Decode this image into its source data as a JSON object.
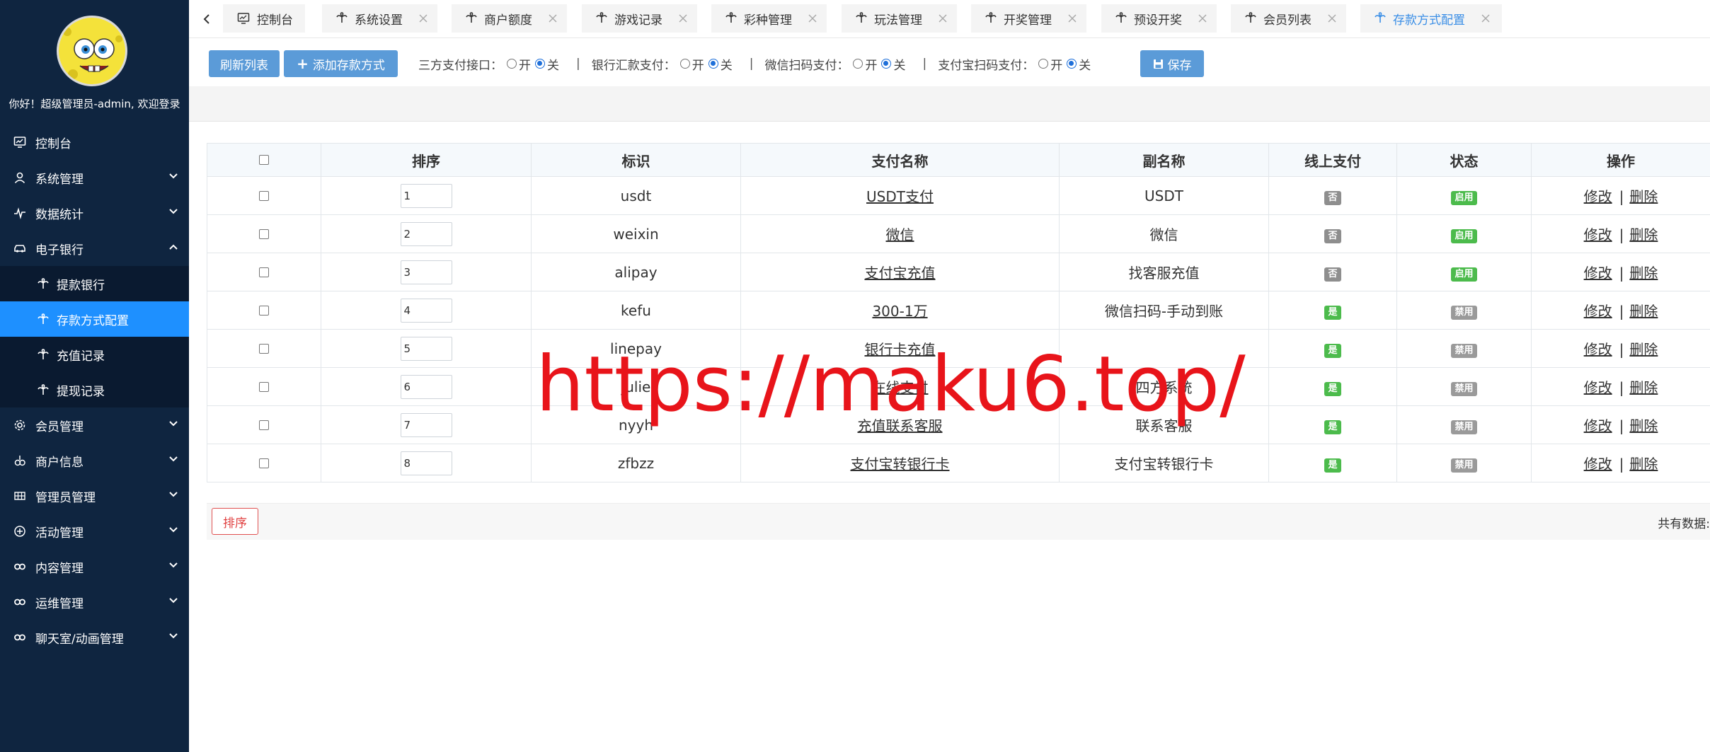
{
  "sidebar": {
    "welcome": "你好！超级管理员-admin, 欢迎登录",
    "items": [
      {
        "label": "控制台",
        "icon": "monitor-icon",
        "has_chevron": false
      },
      {
        "label": "系统管理",
        "icon": "user-icon",
        "has_chevron": true
      },
      {
        "label": "数据统计",
        "icon": "pulse-icon",
        "has_chevron": true
      },
      {
        "label": "电子银行",
        "icon": "car-icon",
        "has_chevron": true,
        "expanded": true
      },
      {
        "label": "会员管理",
        "icon": "gear-icon",
        "has_chevron": true
      },
      {
        "label": "商户信息",
        "icon": "flask-icon",
        "has_chevron": true
      },
      {
        "label": "管理员管理",
        "icon": "grid-icon",
        "has_chevron": true
      },
      {
        "label": "活动管理",
        "icon": "plus-circle-icon",
        "has_chevron": true
      },
      {
        "label": "内容管理",
        "icon": "link-icon",
        "has_chevron": true
      },
      {
        "label": "运维管理",
        "icon": "link-icon",
        "has_chevron": true
      },
      {
        "label": "聊天室/动画管理",
        "icon": "link-icon",
        "has_chevron": true
      }
    ],
    "subitems": [
      {
        "label": "提款银行",
        "active": false
      },
      {
        "label": "存款方式配置",
        "active": true
      },
      {
        "label": "充值记录",
        "active": false
      },
      {
        "label": "提现记录",
        "active": false
      }
    ]
  },
  "tabs": [
    {
      "label": "控制台",
      "closable": false
    },
    {
      "label": "系统设置",
      "closable": true
    },
    {
      "label": "商户额度",
      "closable": true
    },
    {
      "label": "游戏记录",
      "closable": true
    },
    {
      "label": "彩种管理",
      "closable": true
    },
    {
      "label": "玩法管理",
      "closable": true
    },
    {
      "label": "开奖管理",
      "closable": true
    },
    {
      "label": "预设开奖",
      "closable": true
    },
    {
      "label": "会员列表",
      "closable": true
    },
    {
      "label": "存款方式配置",
      "closable": true,
      "active": true
    }
  ],
  "toolbar": {
    "refresh_label": "刷新列表",
    "add_label": "添加存款方式",
    "save_label": "保存",
    "on_label": "开",
    "off_label": "关",
    "sep": "|",
    "groups": [
      {
        "label": "三方支付接口：",
        "value": "off"
      },
      {
        "label": "银行汇款支付：",
        "value": "off"
      },
      {
        "label": "微信扫码支付：",
        "value": "off"
      },
      {
        "label": "支付宝扫码支付：",
        "value": "off"
      }
    ]
  },
  "table": {
    "columns": [
      "排序",
      "标识",
      "支付名称",
      "副名称",
      "线上支付",
      "状态",
      "操作"
    ],
    "edit_label": "修改",
    "delete_label": "删除",
    "rows": [
      {
        "order": "1",
        "key": "usdt",
        "name": "USDT支付",
        "subname": "USDT",
        "online": "否",
        "status": "启用"
      },
      {
        "order": "2",
        "key": "weixin",
        "name": "微信",
        "subname": "微信",
        "online": "否",
        "status": "启用"
      },
      {
        "order": "3",
        "key": "alipay",
        "name": "支付宝充值",
        "subname": "找客服充值",
        "online": "否",
        "status": "启用"
      },
      {
        "order": "4",
        "key": "kefu",
        "name": "300-1万",
        "subname": "微信扫码-手动到账",
        "online": "是",
        "status": "禁用"
      },
      {
        "order": "5",
        "key": "linepay",
        "name": "银行卡充值",
        "subname": "",
        "online": "是",
        "status": "禁用"
      },
      {
        "order": "6",
        "key": "julie",
        "name": "在线支付",
        "subname": "四方系统",
        "online": "是",
        "status": "禁用"
      },
      {
        "order": "7",
        "key": "nyyh",
        "name": "充值联系客服",
        "subname": "联系客服",
        "online": "是",
        "status": "禁用"
      },
      {
        "order": "8",
        "key": "zfbzz",
        "name": "支付宝转银行卡",
        "subname": "支付宝转银行卡",
        "online": "是",
        "status": "禁用"
      }
    ]
  },
  "footer": {
    "sort_label": "排序",
    "total_label": "共有数据:"
  },
  "watermark": "https://maku6.top/",
  "colors": {
    "sidebar_bg": "#0f2540",
    "active_blue": "#1e90ff",
    "button_blue": "#5b9bd8",
    "badge_green": "#4cbb4c",
    "badge_gray": "#8e8e8e",
    "watermark_red": "#e8141a"
  }
}
